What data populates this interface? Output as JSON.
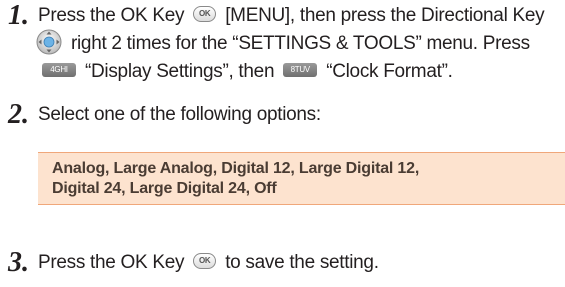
{
  "steps": [
    {
      "number": "1.",
      "lines": [
        {
          "before_ok": "Press the OK Key",
          "ok_key_label": "OK",
          "after_ok": "[MENU], then press the Directional Key"
        },
        {
          "after_dpad": "right 2 times for the “SETTINGS & TOOLS” menu. Press"
        },
        {
          "key1_label": "4GHI",
          "after_key1": "“Display Settings”, then",
          "key2_label": "8TUV",
          "after_key2": "“Clock Format”."
        }
      ]
    },
    {
      "number": "2.",
      "text": "Select one of the following options:"
    },
    {
      "number": "3.",
      "before_ok": "Press the OK Key",
      "ok_key_label": "OK",
      "after_ok": "to save the setting."
    }
  ],
  "options": {
    "line1": "Analog, Large Analog, Digital 12, Large Digital 12,",
    "line2": "Digital 24, Large Digital 24, Off"
  },
  "colors": {
    "option_background": "#fde3cf",
    "option_border": "#f0a77a",
    "text": "#231f20"
  },
  "icons": {
    "ok": "ok-key-icon",
    "dpad": "directional-key-icon",
    "key4": "key-4-icon",
    "key8": "key-8-icon"
  }
}
